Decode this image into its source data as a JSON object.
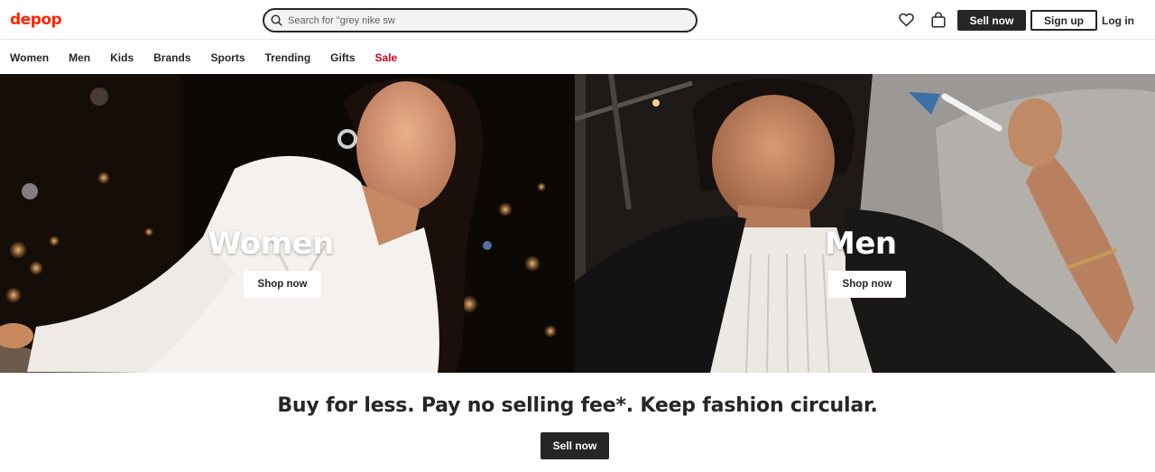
{
  "header": {
    "logo": "depop",
    "search_value": "Search for \"grey nike sw",
    "heart_icon": "heart-icon",
    "bag_icon": "shopping-bag-icon",
    "sell_now": "Sell now",
    "sign_up": "Sign up",
    "log_in": "Log in"
  },
  "nav": {
    "items": [
      "Women",
      "Men",
      "Kids",
      "Brands",
      "Sports",
      "Trending",
      "Gifts",
      "Sale"
    ]
  },
  "hero": {
    "left": {
      "title": "Women",
      "button": "Shop now"
    },
    "right": {
      "title": "Men",
      "button": "Shop now"
    }
  },
  "tagline": "Buy for less. Pay no selling fee*. Keep fashion circular.",
  "cta": "Sell now",
  "colors": {
    "brand": "#ff2300",
    "sale": "#d6001c",
    "dark": "#262626"
  }
}
